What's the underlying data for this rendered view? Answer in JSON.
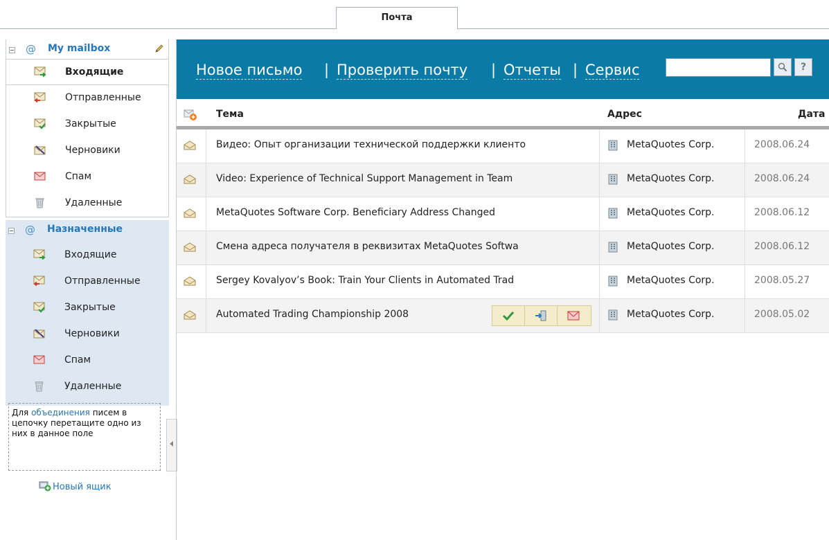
{
  "tab": {
    "label": "Почта"
  },
  "mailbox": {
    "title": "My mailbox",
    "folders": [
      {
        "label": "Входящие",
        "icon": "inbox-icon",
        "active": true
      },
      {
        "label": "Отправленные",
        "icon": "sent-icon"
      },
      {
        "label": "Закрытые",
        "icon": "closed-icon"
      },
      {
        "label": "Черновики",
        "icon": "drafts-icon"
      },
      {
        "label": "Спам",
        "icon": "spam-icon"
      },
      {
        "label": "Удаленные",
        "icon": "trash-icon"
      }
    ]
  },
  "assigned": {
    "title": "Назначенные",
    "folders": [
      {
        "label": "Входящие",
        "icon": "inbox-icon"
      },
      {
        "label": "Отправленные",
        "icon": "sent-icon"
      },
      {
        "label": "Закрытые",
        "icon": "closed-icon"
      },
      {
        "label": "Черновики",
        "icon": "drafts-icon"
      },
      {
        "label": "Спам",
        "icon": "spam-icon"
      },
      {
        "label": "Удаленные",
        "icon": "trash-icon"
      }
    ]
  },
  "hint": {
    "before": "Для ",
    "link": "объединения",
    "after": " писем в цепочку перетащите одно из них в данное поле"
  },
  "new_box": "Новый ящик",
  "toolbar": {
    "new_mail": "Новое письмо",
    "check_mail": "Проверить почту",
    "reports": "Отчеты",
    "service": "Сервис",
    "separator": "|",
    "search_value": "",
    "help": "?"
  },
  "columns": {
    "subject": "Тема",
    "address": "Адрес",
    "date": "Дата"
  },
  "messages": [
    {
      "subject": "Видео: Опыт организации технической поддержки клиенто",
      "address": "MetaQuotes Corp.",
      "date": "2008.06.24"
    },
    {
      "subject": "Video: Experience of Technical Support Management in Team",
      "address": "MetaQuotes Corp.",
      "date": "2008.06.24"
    },
    {
      "subject": "MetaQuotes Software Corp. Beneficiary Address Changed",
      "address": "MetaQuotes Corp.",
      "date": "2008.06.12"
    },
    {
      "subject": "Смена адреса получателя в реквизитах MetaQuotes Softwa",
      "address": "MetaQuotes Corp.",
      "date": "2008.06.12"
    },
    {
      "subject": "Sergey Kovalyov’s Book: Train Your Clients in Automated Trad",
      "address": "MetaQuotes Corp.",
      "date": "2008.05.27"
    },
    {
      "subject": "Automated Trading Championship 2008",
      "address": "MetaQuotes Corp.",
      "date": "2008.05.02",
      "hovered": true
    }
  ],
  "colors": {
    "toolbar": "#0a7ba6",
    "link": "#2676b8",
    "assigned_bg": "#dde8f2"
  }
}
